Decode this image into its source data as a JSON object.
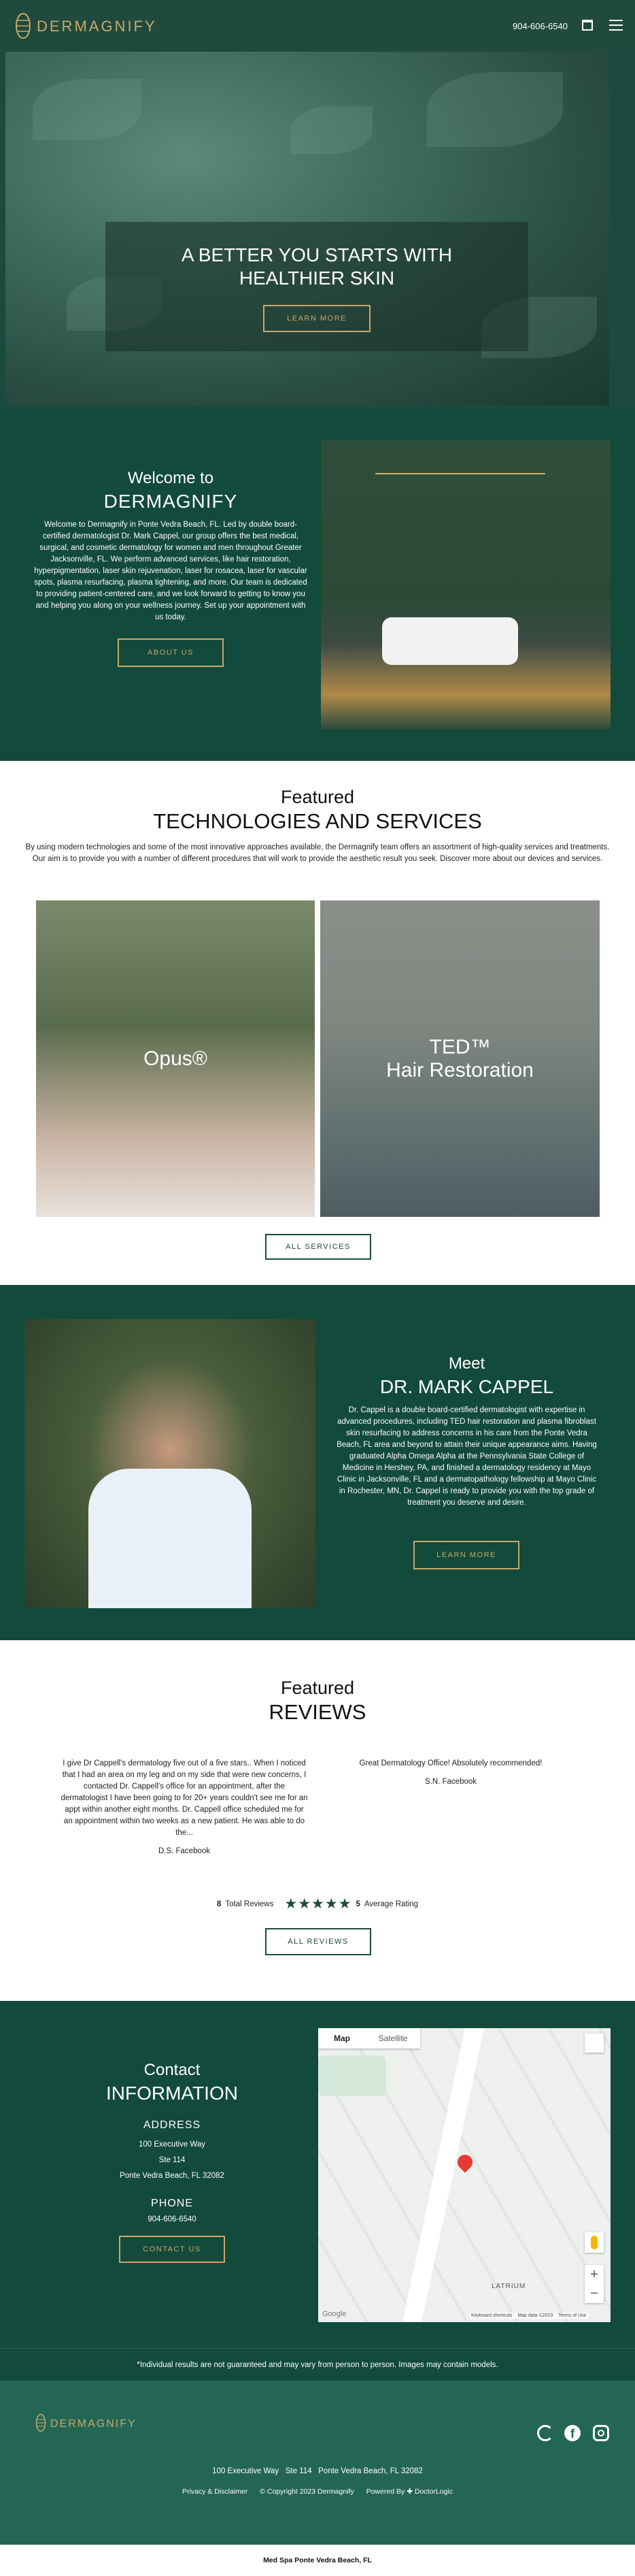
{
  "header": {
    "brand": "DERMAGNIFY",
    "phone": "904-606-6540"
  },
  "hero": {
    "title_line1": "A BETTER YOU STARTS WITH",
    "title_line2": "HEALTHIER SKIN",
    "button": "LEARN MORE"
  },
  "welcome": {
    "kicker": "Welcome to",
    "heading": "DERMAGNIFY",
    "body": "Welcome to Dermagnify in Ponte Vedra Beach, FL. Led by double board-certified dermatologist Dr. Mark Cappel, our group offers the best medical, surgical, and cosmetic dermatology for women and men throughout Greater Jacksonville, FL. We perform advanced services, like hair restoration, hyperpigmentation, laser skin rejuvenation, laser for rosacea, laser for vascular spots, plasma resurfacing, plasma tightening, and more. Our team is dedicated to providing patient-centered care, and we look forward to getting to know you and helping you along on your wellness journey. Set up your appointment with us today.",
    "button": "ABOUT US"
  },
  "services": {
    "kicker": "Featured",
    "heading": "TECHNOLOGIES AND SERVICES",
    "body": "By using modern technologies and some of the most innovative approaches available, the Dermagnify team offers an assortment of high-quality services and treatments. Our aim is to provide you with a number of different procedures that will work to provide the aesthetic result you seek. Discover more about our devices and services.",
    "cards": [
      {
        "label": "Opus®"
      },
      {
        "label_line1": "TED™",
        "label_line2": "Hair Restoration"
      }
    ],
    "button": "ALL SERVICES"
  },
  "doctor": {
    "kicker": "Meet",
    "heading": "DR. MARK CAPPEL",
    "body": "Dr. Cappel is a double board-certified dermatologist with expertise in advanced procedures, including TED hair restoration and plasma fibroblast skin resurfacing to address concerns in his care from the Ponte Vedra Beach, FL area and beyond to attain their unique appearance aims. Having graduated Alpha Omega Alpha at the Pennsylvania State College of Medicine in Hershey, PA, and finished a dermatology residency at Mayo Clinic in Jacksonville, FL and a dermatopathology fellowship at Mayo Clinic in Rochester, MN, Dr. Cappel is ready to provide you with the top grade of treatment you deserve and desire.",
    "button": "LEARN MORE"
  },
  "reviews": {
    "kicker": "Featured",
    "heading": "REVIEWS",
    "items": [
      {
        "text": "I give Dr Cappell's dermatology five out of a five stars.. When I noticed that I had an area on my leg and on my side that were new concerns, I contacted Dr. Cappell's office for an appointment, after the dermatologist I have been going to for 20+ years couldn't see me for an appt within another eight months. Dr. Cappell office scheduled me for an appointment within two weeks as a new patient. He was able to do the...",
        "author": "D.S. Facebook"
      },
      {
        "text": "Great Dermatology Office! Absolutely recommended!",
        "author": "S.N. Facebook"
      }
    ],
    "total_count": "8",
    "total_label": "Total Reviews",
    "stars": "★★★★★",
    "rating": "5",
    "rating_label": "Average Rating",
    "button": "ALL REVIEWS"
  },
  "contact": {
    "kicker": "Contact",
    "heading": "INFORMATION",
    "address_label": "ADDRESS",
    "address_line1": "100 Executive Way",
    "address_line2": "Ste 114",
    "address_line3": "Ponte Vedra Beach, FL 32082",
    "phone_label": "PHONE",
    "phone": "904-606-6540",
    "button": "CONTACT US"
  },
  "map": {
    "tab_map": "Map",
    "tab_satellite": "Satellite",
    "place": "LATRIUM",
    "attr1": "Keyboard shortcuts",
    "attr2": "Map data ©2023",
    "attr3": "Terms of Use",
    "google": "Google"
  },
  "disclaimer": "*Individual results are not guaranteed and may vary from person to person. Images may contain models.",
  "footer": {
    "brand": "DERMAGNIFY",
    "address": "100 Executive Way   Ste 114   Ponte Vedra Beach, FL 32082",
    "privacy": "Privacy & Disclaimer",
    "copyright": "© Copyright 2023 Dermagnify",
    "powered": "Powered By",
    "doctorlogic": "DoctorLogic",
    "bottom": "Med Spa Ponte Vedra Beach, FL"
  },
  "colors": {
    "primary_green": "#124a3c",
    "accent_gold": "#c9a86a"
  }
}
